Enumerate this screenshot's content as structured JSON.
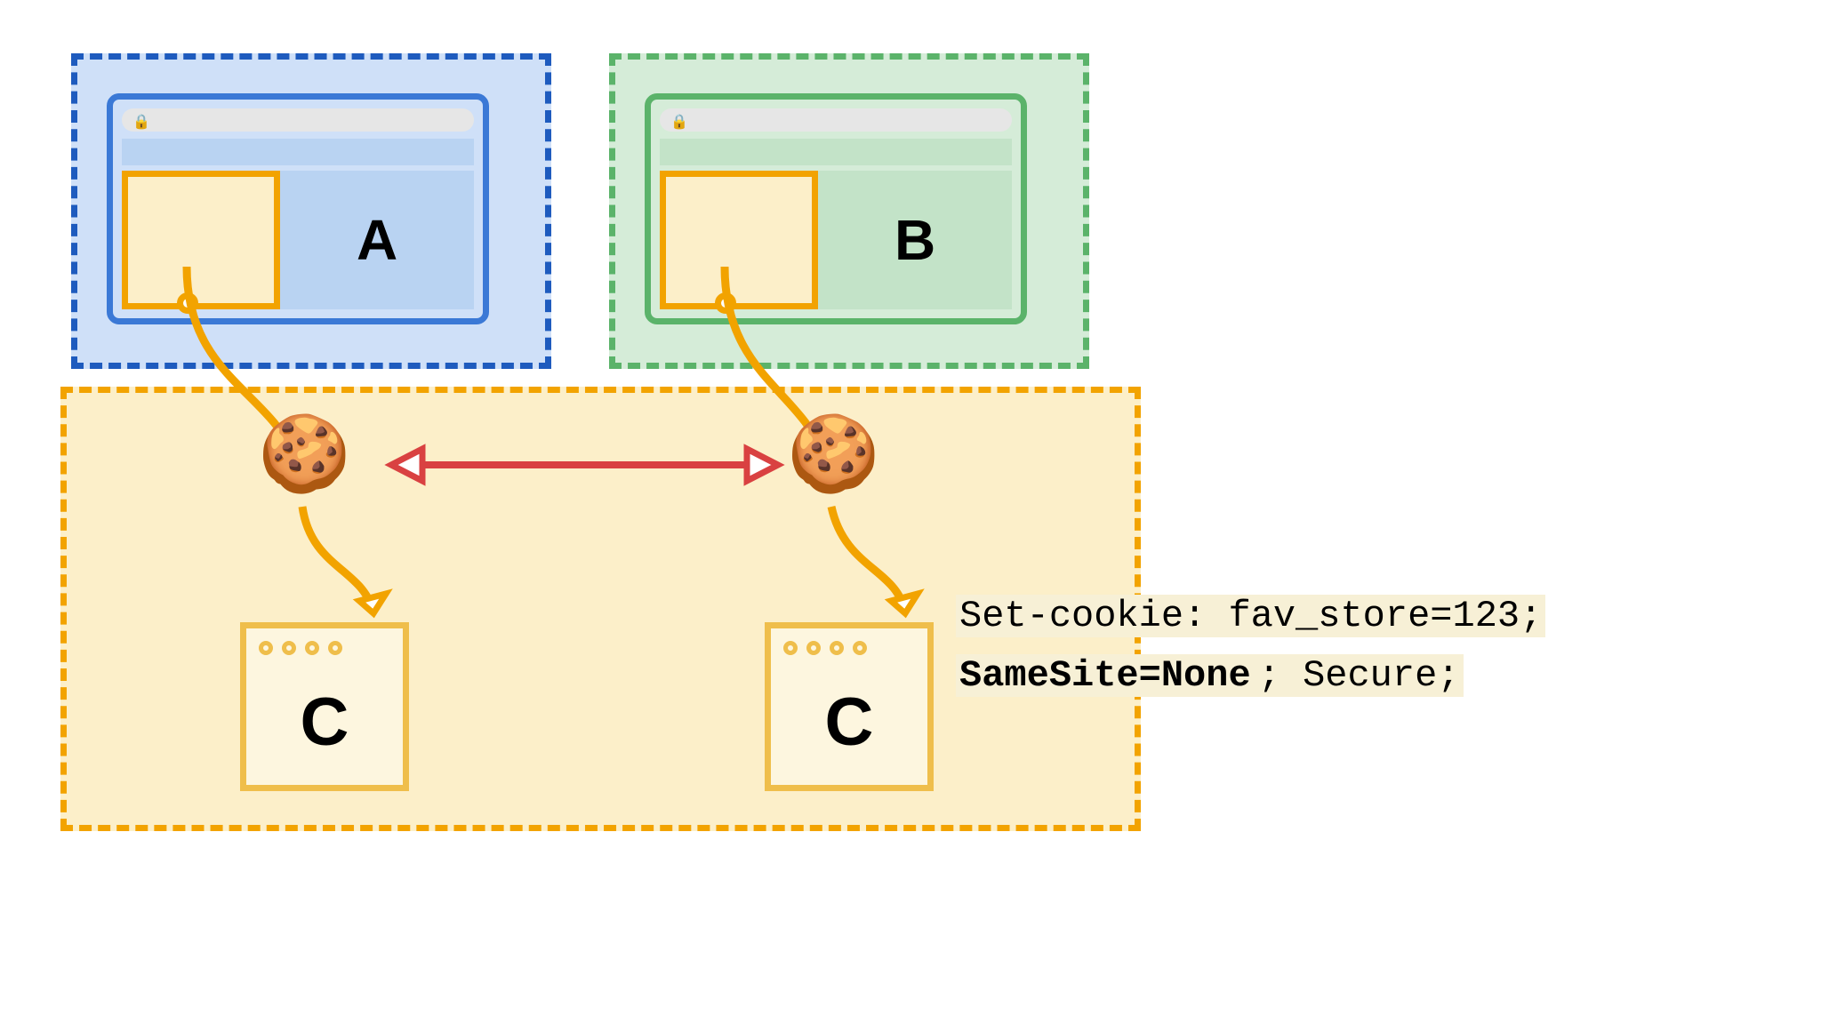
{
  "sites": {
    "a_label": "A",
    "b_label": "B",
    "c_label": "C"
  },
  "header": {
    "line1_prefix": "Set-cookie: fav_store=123;",
    "line2_bold": "SameSite=None",
    "line2_rest": "; Secure;"
  },
  "colors": {
    "blue_border": "#1E5BBE",
    "green_border": "#5BB36A",
    "orange_border": "#F2A300",
    "arrow_red": "#D94141",
    "connector_orange": "#F2A300"
  }
}
